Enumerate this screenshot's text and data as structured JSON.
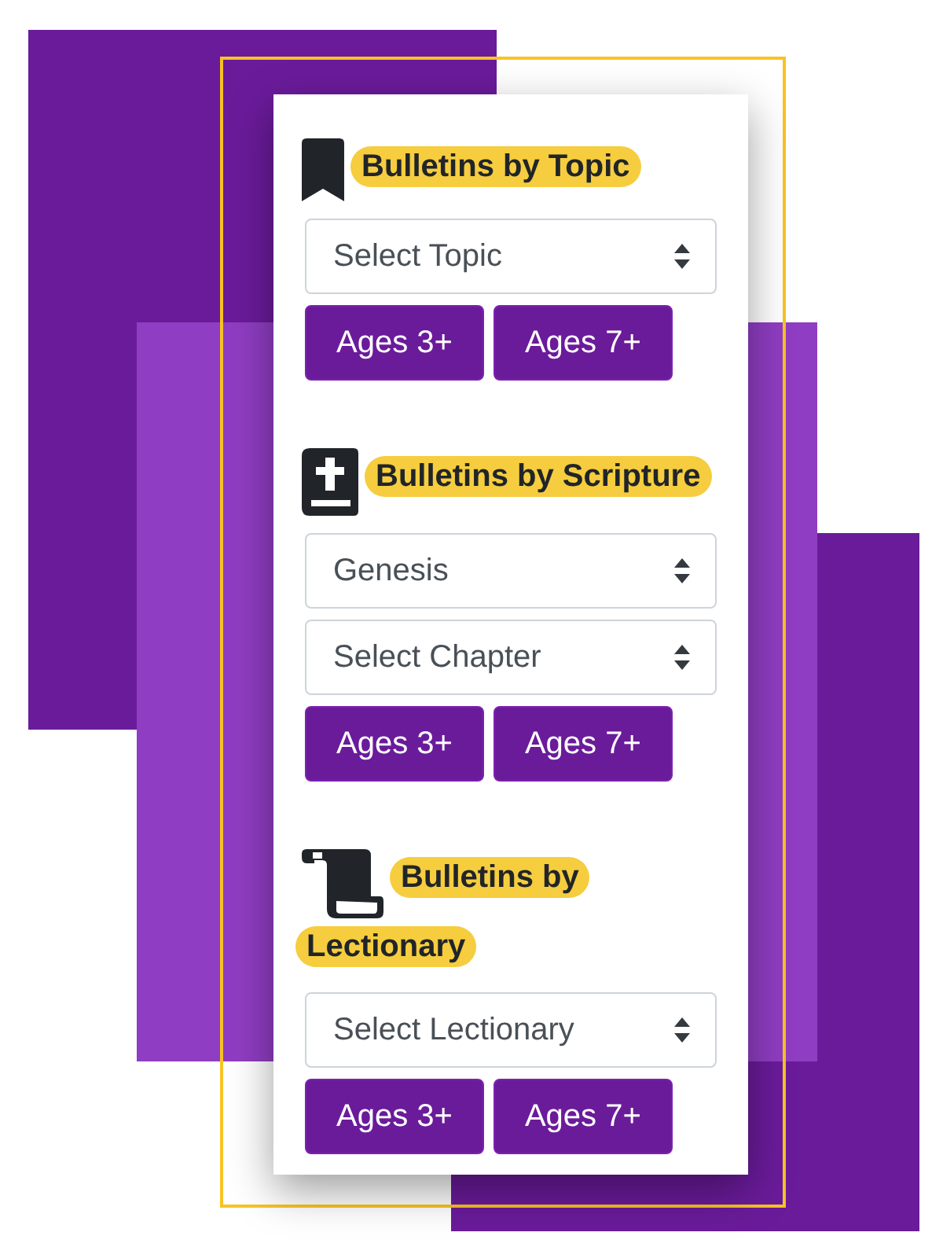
{
  "sections": [
    {
      "kind": "topic",
      "heading": "Bulletins by Topic",
      "selects": [
        {
          "value": "Select Topic"
        }
      ],
      "buttons": [
        "Ages 3+",
        "Ages 7+"
      ]
    },
    {
      "kind": "scripture",
      "heading": "Bulletins by Scripture",
      "selects": [
        {
          "value": "Genesis"
        },
        {
          "value": "Select Chapter"
        }
      ],
      "buttons": [
        "Ages 3+",
        "Ages 7+"
      ]
    },
    {
      "kind": "lectionary",
      "heading": "Bulletins by Lectionary",
      "selects": [
        {
          "value": "Select Lectionary"
        }
      ],
      "buttons": [
        "Ages 3+",
        "Ages 7+"
      ]
    }
  ]
}
